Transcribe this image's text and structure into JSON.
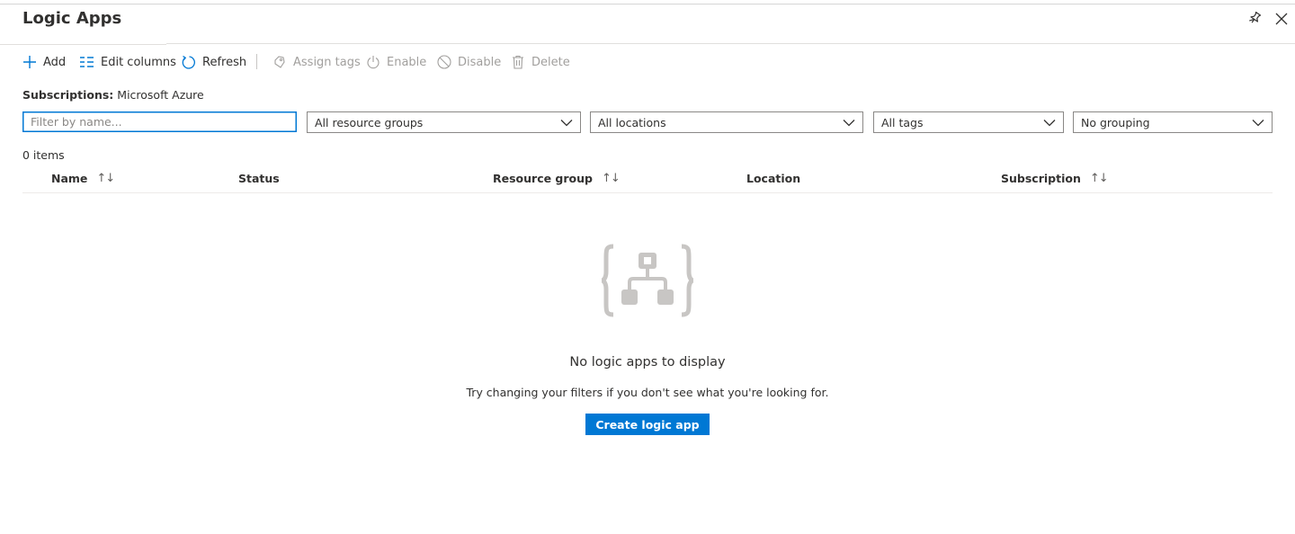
{
  "header": {
    "title": "Logic Apps",
    "pin_icon": "pin-icon",
    "close_icon": "close-icon"
  },
  "toolbar": {
    "add": "Add",
    "edit_columns": "Edit columns",
    "refresh": "Refresh",
    "assign_tags": "Assign tags",
    "enable": "Enable",
    "disable": "Disable",
    "delete": "Delete"
  },
  "subscriptions": {
    "label": "Subscriptions:",
    "value": "Microsoft Azure"
  },
  "filters": {
    "name_placeholder": "Filter by name...",
    "name_value": "",
    "resource_groups": "All resource groups",
    "locations": "All locations",
    "tags": "All tags",
    "grouping": "No grouping"
  },
  "table": {
    "count": "0 items",
    "columns": [
      "Name",
      "Status",
      "Resource group",
      "Location",
      "Subscription"
    ],
    "sort_glyph": "↑↓",
    "rows": []
  },
  "empty_state": {
    "icon": "logic-app-icon",
    "title": "No logic apps to display",
    "subtitle": "Try changing your filters if you don't see what you're looking for.",
    "button": "Create logic app"
  },
  "colors": {
    "accent": "#0078d4",
    "text": "#323130",
    "disabled": "#a19f9d",
    "empty_icon": "#c8c6c4"
  }
}
